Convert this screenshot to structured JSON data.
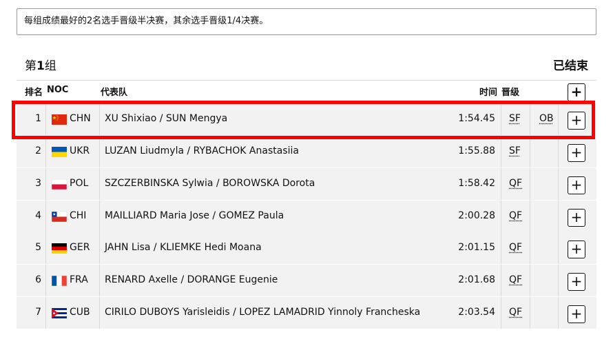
{
  "notice": "每组成绩最好的2名选手晋级半决赛，其余选手晋级1/4决赛。",
  "group": {
    "prefix": "第",
    "number": "1",
    "suffix": "组",
    "status": "已结束"
  },
  "columns": {
    "rank": "排名",
    "noc": "NOC",
    "team": "代表队",
    "time": "时间",
    "qual": "晋级"
  },
  "expand_label": "+",
  "rows": [
    {
      "rank": "1",
      "noc": "CHN",
      "team": "XU Shixiao / SUN Mengya",
      "time": "1:54.45",
      "qual": "SF",
      "extra": "OB",
      "flag": "chn-flag"
    },
    {
      "rank": "2",
      "noc": "UKR",
      "team": "LUZAN Liudmyla / RYBACHOK Anastasiia",
      "time": "1:55.88",
      "qual": "SF",
      "extra": "",
      "flag": "ukr-flag"
    },
    {
      "rank": "3",
      "noc": "POL",
      "team": "SZCZERBINSKA Sylwia / BOROWSKA Dorota",
      "time": "1:58.42",
      "qual": "QF",
      "extra": "",
      "flag": "pol-flag"
    },
    {
      "rank": "4",
      "noc": "CHI",
      "team": "MAILLIARD Maria Jose / GOMEZ Paula",
      "time": "2:00.28",
      "qual": "QF",
      "extra": "",
      "flag": "chi-flag"
    },
    {
      "rank": "5",
      "noc": "GER",
      "team": "JAHN Lisa / KLIEMKE Hedi Moana",
      "time": "2:01.15",
      "qual": "QF",
      "extra": "",
      "flag": "ger-flag"
    },
    {
      "rank": "6",
      "noc": "FRA",
      "team": "RENARD Axelle / DORANGE Eugenie",
      "time": "2:01.68",
      "qual": "QF",
      "extra": "",
      "flag": "fra-flag"
    },
    {
      "rank": "7",
      "noc": "CUB",
      "team": "CIRILO DUBOYS Yarisleidis / LOPEZ LAMADRID Yinnoly Francheska",
      "time": "2:03.54",
      "qual": "QF",
      "extra": "",
      "flag": "cub-flag"
    }
  ],
  "colors": {
    "highlight": "#ff0000",
    "row_bg": "#f2f2f2"
  }
}
